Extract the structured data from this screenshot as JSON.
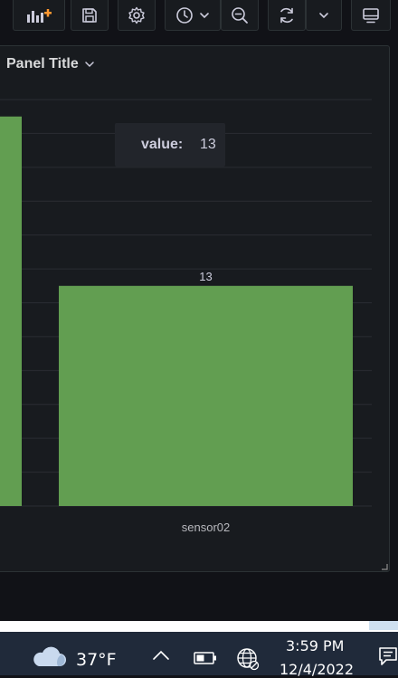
{
  "toolbar": {
    "buttons": [
      {
        "name": "add-panel-icon"
      },
      {
        "name": "save-icon"
      },
      {
        "name": "gear-icon"
      },
      {
        "name": "clock-icon"
      },
      {
        "name": "zoom-out-icon"
      },
      {
        "name": "refresh-icon"
      },
      {
        "name": "chevron-down-icon"
      },
      {
        "name": "tv-monitor-icon"
      }
    ],
    "accent": "#ff9830"
  },
  "panel": {
    "title": "Panel Title"
  },
  "chart_data": {
    "type": "bar",
    "categories": [
      "",
      "sensor02"
    ],
    "values": [
      23,
      13
    ],
    "value_labels": [
      "",
      "13"
    ],
    "ylim": [
      0,
      24
    ],
    "grid": true,
    "bar_color": "#629e51",
    "tooltip": {
      "label": "value:",
      "value": "13"
    }
  },
  "taskbar": {
    "temperature": "37°F",
    "time": "3:59 PM",
    "date": "12/4/2022",
    "icons": [
      "cloud-icon",
      "chevron-up-icon",
      "battery-icon",
      "globe-icon",
      "notification-icon"
    ]
  }
}
